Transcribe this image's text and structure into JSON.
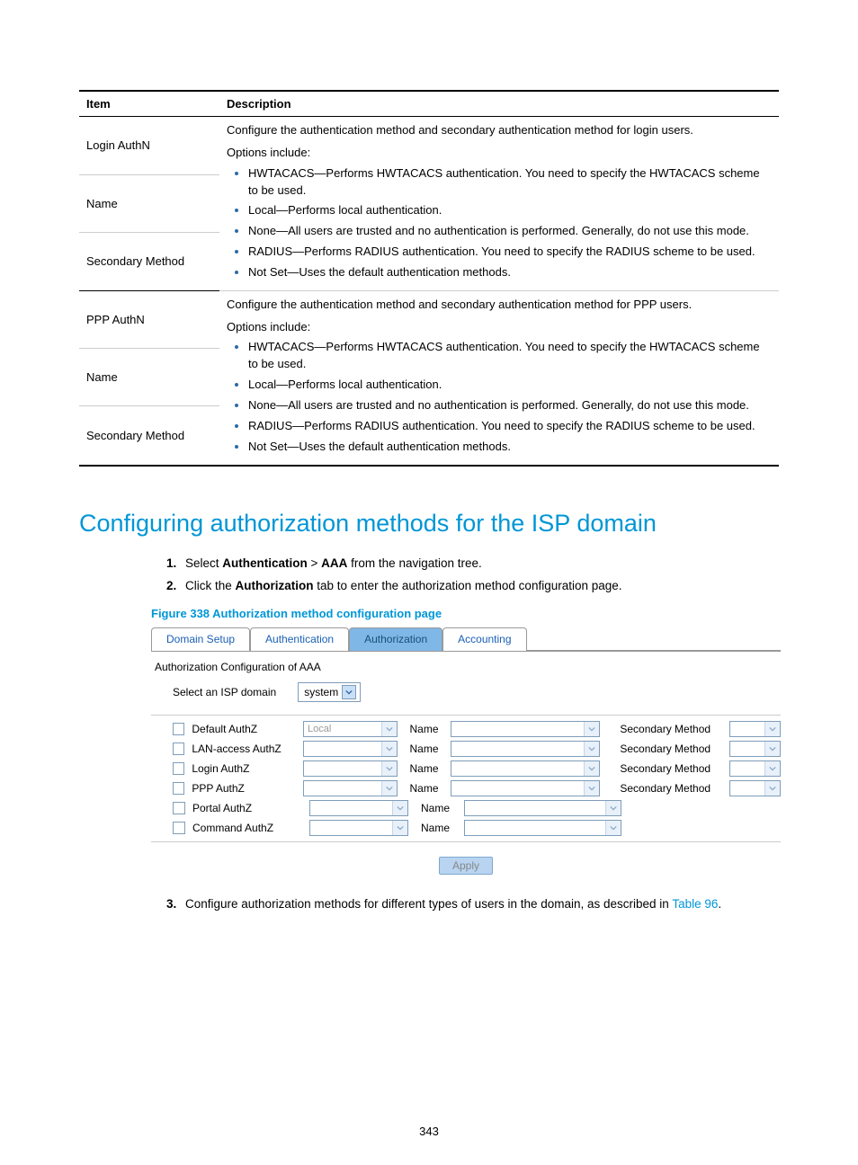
{
  "table": {
    "headers": [
      "Item",
      "Description"
    ],
    "rows": [
      {
        "item": "Login AuthN"
      },
      {
        "item": "Name"
      },
      {
        "item": "Secondary Method"
      },
      {
        "item": "PPP AuthN"
      },
      {
        "item": "Name"
      },
      {
        "item": "Secondary Method"
      }
    ],
    "desc_login_intro": "Configure the authentication method and secondary authentication method for login users.",
    "desc_ppp_intro": "Configure the authentication method and secondary authentication method for PPP users.",
    "options_label": "Options include:",
    "options": [
      "HWTACACS—Performs HWTACACS authentication. You need to specify the HWTACACS scheme to be used.",
      "Local—Performs local authentication.",
      "None—All users are trusted and no authentication is performed. Generally, do not use this mode.",
      "RADIUS—Performs RADIUS authentication. You need to specify the RADIUS scheme to be used.",
      "Not Set—Uses the default authentication methods."
    ]
  },
  "section_title": "Configuring authorization methods for the ISP domain",
  "steps": {
    "s1_pre": "Select ",
    "s1_b1": "Authentication",
    "s1_sep": " > ",
    "s1_b2": "AAA",
    "s1_post": " from the navigation tree.",
    "s2_pre": "Click the ",
    "s2_b1": "Authorization",
    "s2_post": " tab to enter the authorization method configuration page.",
    "s3_pre": "Configure authorization methods for different types of users in the domain, as described in ",
    "s3_link": "Table 96",
    "s3_post": "."
  },
  "figure_caption": "Figure 338 Authorization method configuration page",
  "ui": {
    "tabs": [
      "Domain Setup",
      "Authentication",
      "Authorization",
      "Accounting"
    ],
    "active_tab": "Authorization",
    "section_label": "Authorization Configuration of AAA",
    "select_domain_label": "Select an ISP domain",
    "select_domain_value": "system",
    "name_label": "Name",
    "secondary_label": "Secondary Method",
    "apply_label": "Apply",
    "rows": [
      {
        "label": "Default AuthZ",
        "method": "Local",
        "has_secondary": true
      },
      {
        "label": "LAN-access AuthZ",
        "method": "",
        "has_secondary": true
      },
      {
        "label": "Login AuthZ",
        "method": "",
        "has_secondary": true
      },
      {
        "label": "PPP AuthZ",
        "method": "",
        "has_secondary": true
      },
      {
        "label": "Portal AuthZ",
        "method": "",
        "has_secondary": false
      },
      {
        "label": "Command AuthZ",
        "method": "",
        "has_secondary": false
      }
    ]
  },
  "page_number": "343"
}
